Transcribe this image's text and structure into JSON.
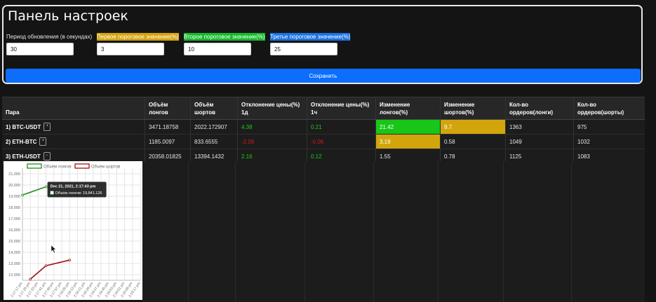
{
  "settings": {
    "title": "Панель настроек",
    "fields": [
      {
        "label": "Период обновления (в секундах)",
        "value": "30"
      },
      {
        "label": "Первое пороговое значение(%)",
        "value": "3"
      },
      {
        "label": "Второе пороговое значение(%)",
        "value": "10"
      },
      {
        "label": "Третье пороговое значение(%)",
        "value": "25"
      }
    ],
    "save_label": "Сохранить",
    "colors": {
      "threshold1": "#d4a20c",
      "threshold2": "#17b82e",
      "threshold3": "#1a73e0",
      "save": "#0d6efd"
    }
  },
  "table": {
    "headers": {
      "pair": "Пара",
      "longs_vol": [
        "Объём",
        "лонгов"
      ],
      "shorts_vol": [
        "Объём",
        "шортов"
      ],
      "dev_1d": [
        "Отклонение цены(%)",
        "1д"
      ],
      "dev_1h": [
        "Отклонение цены(%)",
        "1ч"
      ],
      "long_change": [
        "Изменение",
        "лонгов(%)"
      ],
      "short_change": [
        "Изменение",
        "шортов(%)"
      ],
      "orders_long": [
        "Кол-во",
        "ордеров(лонги)"
      ],
      "orders_short": [
        "Кол-во",
        "ордеров(шорты)"
      ]
    },
    "rows": [
      {
        "pair": "1) BTC-USDT",
        "toggle": "+",
        "longs_vol": "3471.18758",
        "shorts_vol": "2022.172907",
        "dev_1d": "4.38",
        "dev_1h": "0.21",
        "long_change": "21.42",
        "short_change": "9.7",
        "orders_long": "1363",
        "orders_short": "975"
      },
      {
        "pair": "2) ETH-BTC",
        "toggle": "+",
        "longs_vol": "1185.0097",
        "shorts_vol": "833.6555",
        "dev_1d": "-2.09",
        "dev_1h": "-0.06",
        "long_change": "3.19",
        "short_change": "0.58",
        "orders_long": "1049",
        "orders_short": "1032"
      },
      {
        "pair": "3) ETH-USDT",
        "toggle": "−",
        "longs_vol": "20358.01825",
        "shorts_vol": "13394.1432",
        "dev_1d": "2.16",
        "dev_1h": "0.12",
        "long_change": "1.55",
        "short_change": "0.78",
        "orders_long": "1125",
        "orders_short": "1083"
      }
    ]
  },
  "chart_data": {
    "type": "line",
    "title": "",
    "xlabel": "",
    "ylabel": "",
    "ylim": [
      11500,
      21500
    ],
    "grid": true,
    "legend_position": "top-center",
    "x": [
      "2:17:17 pm",
      "2:17:25 pm",
      "2:17:33 pm",
      "2:17:41 pm",
      "2:17:49 pm",
      "2:17:57 pm",
      "2:18:05 pm",
      "2:18:13 pm",
      "2:18:21 pm",
      "2:18:29 pm",
      "2:18:37 pm",
      "2:18:45 pm",
      "2:18:53 pm",
      "2:19:01 pm",
      "2:19:09 pm",
      "2:19:17 pm"
    ],
    "y_ticks": [
      "12,000",
      "13,000",
      "14,000",
      "15,000",
      "16,000",
      "17,000",
      "18,000",
      "19,000",
      "20,000",
      "21,000"
    ],
    "series": [
      {
        "name": "Объём лонгов",
        "color": "#1e8a1e",
        "points": [
          [
            0,
            19100
          ],
          [
            3,
            19841.126
          ]
        ]
      },
      {
        "name": "Объём шортов",
        "color": "#a01010",
        "points": [
          [
            1,
            11600
          ],
          [
            3,
            12800
          ],
          [
            6,
            13300
          ]
        ]
      }
    ],
    "tooltip": {
      "title": "Dec 21, 2021, 2:17:43 pm",
      "text": "Объём лонгов: 19,841.126"
    }
  }
}
